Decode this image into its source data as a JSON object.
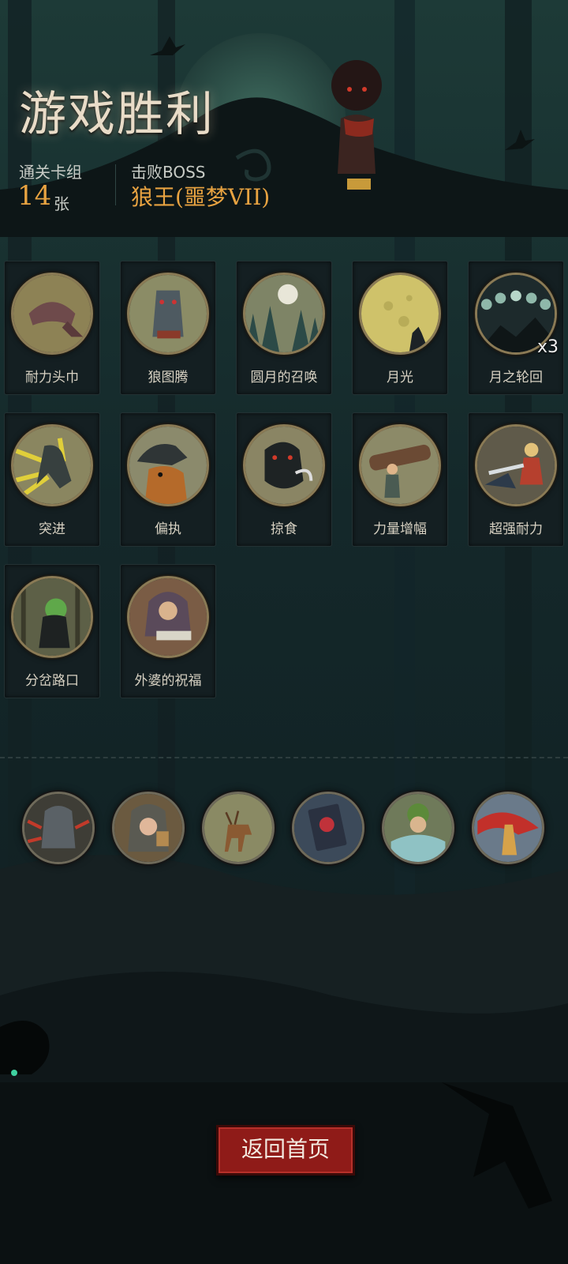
{
  "header": {
    "title": "游戏胜利",
    "deck_label": "通关卡组",
    "deck_count": "14",
    "deck_unit": "张",
    "boss_label": "击败BOSS",
    "boss_name": "狼王(噩梦VII)"
  },
  "cards": [
    {
      "name": "耐力头巾",
      "icon": "bandana-icon"
    },
    {
      "name": "狼图腾",
      "icon": "wolf-totem-icon"
    },
    {
      "name": "圆月的召唤",
      "icon": "full-moon-forest-icon"
    },
    {
      "name": "月光",
      "icon": "moonlight-icon"
    },
    {
      "name": "月之轮回",
      "icon": "moon-phases-icon",
      "count": "x3"
    },
    {
      "name": "突进",
      "icon": "dash-wolf-icon"
    },
    {
      "name": "偏执",
      "icon": "wolf-bear-icon"
    },
    {
      "name": "掠食",
      "icon": "predator-icon"
    },
    {
      "name": "力量增幅",
      "icon": "log-lift-icon"
    },
    {
      "name": "超强耐力",
      "icon": "hero-fight-icon"
    },
    {
      "name": "分岔路口",
      "icon": "crossroad-icon"
    },
    {
      "name": "外婆的祝福",
      "icon": "grandma-icon"
    }
  ],
  "relics": [
    {
      "icon": "werewolf-relic-icon"
    },
    {
      "icon": "hooded-merchant-relic-icon"
    },
    {
      "icon": "deer-relic-icon"
    },
    {
      "icon": "red-book-relic-icon"
    },
    {
      "icon": "forest-spirit-relic-icon"
    },
    {
      "icon": "red-cape-hero-relic-icon"
    }
  ],
  "footer": {
    "home_label": "返回首页"
  }
}
